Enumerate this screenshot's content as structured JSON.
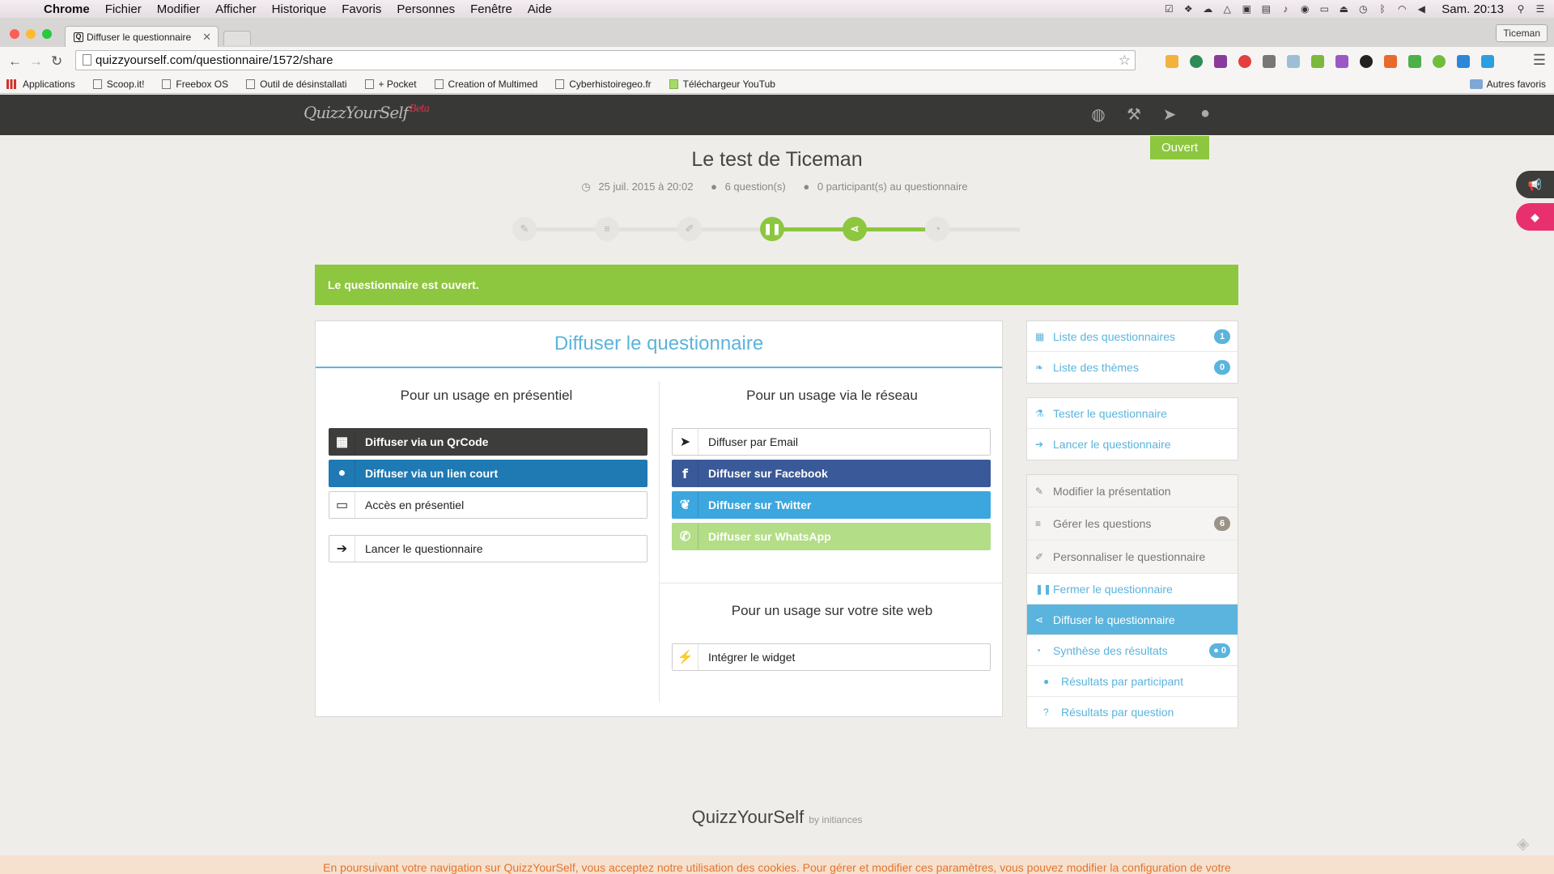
{
  "menubar": {
    "items": [
      "Chrome",
      "Fichier",
      "Modifier",
      "Afficher",
      "Historique",
      "Favoris",
      "Personnes",
      "Fenêtre",
      "Aide"
    ],
    "clock": "Sam. 20:13"
  },
  "browser": {
    "tab_title": "Diffuser le questionnaire",
    "tab_favicon": "Q",
    "profile": "Ticeman",
    "url": "quizzyourself.com/questionnaire/1572/share",
    "bookmarks": [
      "Applications",
      "Scoop.it!",
      "Freebox OS",
      "Outil de désinstallati",
      "+ Pocket",
      "Creation of Multimed",
      "Cyberhistoiregeo.fr",
      "Téléchargeur YouTub"
    ],
    "other_bookmarks": "Autres favoris"
  },
  "app": {
    "logo": "QuizzYourSelf",
    "logo_tag": "Beta",
    "status_badge": "Ouvert",
    "title": "Le test de Ticeman",
    "meta": {
      "date": "25 juil. 2015 à 20:02",
      "questions": "6 question(s)",
      "participants": "0 participant(s) au questionnaire"
    },
    "stepper": {
      "current_step": 5,
      "total_steps": 6
    },
    "alert": "Le questionnaire est ouvert."
  },
  "panel": {
    "title": "Diffuser le questionnaire",
    "col_left_title": "Pour un usage en présentiel",
    "col_right_title": "Pour un usage via le réseau",
    "web_title": "Pour un usage sur votre site web",
    "buttons": {
      "qrcode": "Diffuser via un QrCode",
      "short_link": "Diffuser via un lien court",
      "presentiel": "Accès en présentiel",
      "launch": "Lancer le questionnaire",
      "email": "Diffuser par Email",
      "facebook": "Diffuser sur Facebook",
      "twitter": "Diffuser sur Twitter",
      "whatsapp": "Diffuser sur WhatsApp",
      "widget": "Intégrer le widget"
    }
  },
  "sidebar": {
    "group1": [
      {
        "label": "Liste des questionnaires",
        "badge": "1"
      },
      {
        "label": "Liste des thèmes",
        "badge": "0"
      }
    ],
    "group2": [
      {
        "label": "Tester le questionnaire"
      },
      {
        "label": "Lancer le questionnaire"
      }
    ],
    "group3": [
      {
        "label": "Modifier la présentation"
      },
      {
        "label": "Gérer les questions",
        "badge": "6"
      },
      {
        "label": "Personnaliser le questionnaire"
      },
      {
        "label": "Fermer le questionnaire"
      },
      {
        "label": "Diffuser le questionnaire"
      },
      {
        "label": "Synthèse des résultats",
        "badge": "0"
      },
      {
        "label": "Résultats par participant"
      },
      {
        "label": "Résultats par question"
      }
    ]
  },
  "footer": {
    "logo": "QuizzYourSelf",
    "by": "by initiances",
    "cookie": "En poursuivant votre navigation sur QuizzYourSelf, vous acceptez notre utilisation des cookies. Pour gérer et modifier ces paramètres, vous pouvez modifier la configuration de votre"
  },
  "colors": {
    "accent_green": "#8dc63f",
    "accent_blue": "#5ab4dd",
    "header_dark": "#383836"
  }
}
